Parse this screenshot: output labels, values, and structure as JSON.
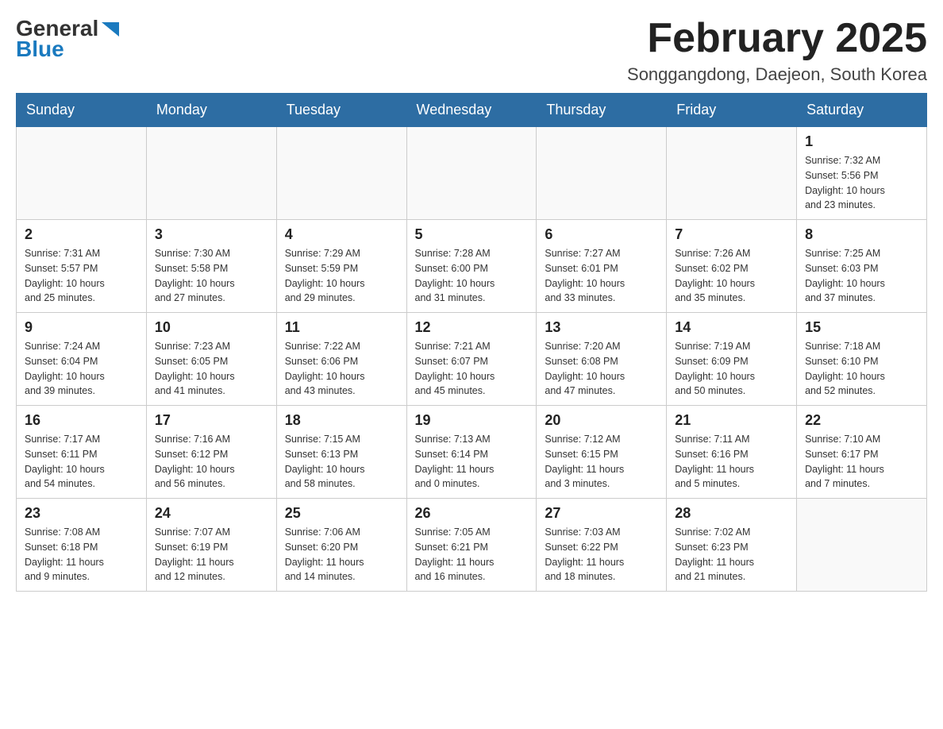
{
  "logo": {
    "general": "General",
    "blue": "Blue",
    "icon": "▶"
  },
  "header": {
    "title": "February 2025",
    "subtitle": "Songgangdong, Daejeon, South Korea"
  },
  "days_of_week": [
    "Sunday",
    "Monday",
    "Tuesday",
    "Wednesday",
    "Thursday",
    "Friday",
    "Saturday"
  ],
  "weeks": [
    [
      {
        "day": "",
        "info": ""
      },
      {
        "day": "",
        "info": ""
      },
      {
        "day": "",
        "info": ""
      },
      {
        "day": "",
        "info": ""
      },
      {
        "day": "",
        "info": ""
      },
      {
        "day": "",
        "info": ""
      },
      {
        "day": "1",
        "info": "Sunrise: 7:32 AM\nSunset: 5:56 PM\nDaylight: 10 hours\nand 23 minutes."
      }
    ],
    [
      {
        "day": "2",
        "info": "Sunrise: 7:31 AM\nSunset: 5:57 PM\nDaylight: 10 hours\nand 25 minutes."
      },
      {
        "day": "3",
        "info": "Sunrise: 7:30 AM\nSunset: 5:58 PM\nDaylight: 10 hours\nand 27 minutes."
      },
      {
        "day": "4",
        "info": "Sunrise: 7:29 AM\nSunset: 5:59 PM\nDaylight: 10 hours\nand 29 minutes."
      },
      {
        "day": "5",
        "info": "Sunrise: 7:28 AM\nSunset: 6:00 PM\nDaylight: 10 hours\nand 31 minutes."
      },
      {
        "day": "6",
        "info": "Sunrise: 7:27 AM\nSunset: 6:01 PM\nDaylight: 10 hours\nand 33 minutes."
      },
      {
        "day": "7",
        "info": "Sunrise: 7:26 AM\nSunset: 6:02 PM\nDaylight: 10 hours\nand 35 minutes."
      },
      {
        "day": "8",
        "info": "Sunrise: 7:25 AM\nSunset: 6:03 PM\nDaylight: 10 hours\nand 37 minutes."
      }
    ],
    [
      {
        "day": "9",
        "info": "Sunrise: 7:24 AM\nSunset: 6:04 PM\nDaylight: 10 hours\nand 39 minutes."
      },
      {
        "day": "10",
        "info": "Sunrise: 7:23 AM\nSunset: 6:05 PM\nDaylight: 10 hours\nand 41 minutes."
      },
      {
        "day": "11",
        "info": "Sunrise: 7:22 AM\nSunset: 6:06 PM\nDaylight: 10 hours\nand 43 minutes."
      },
      {
        "day": "12",
        "info": "Sunrise: 7:21 AM\nSunset: 6:07 PM\nDaylight: 10 hours\nand 45 minutes."
      },
      {
        "day": "13",
        "info": "Sunrise: 7:20 AM\nSunset: 6:08 PM\nDaylight: 10 hours\nand 47 minutes."
      },
      {
        "day": "14",
        "info": "Sunrise: 7:19 AM\nSunset: 6:09 PM\nDaylight: 10 hours\nand 50 minutes."
      },
      {
        "day": "15",
        "info": "Sunrise: 7:18 AM\nSunset: 6:10 PM\nDaylight: 10 hours\nand 52 minutes."
      }
    ],
    [
      {
        "day": "16",
        "info": "Sunrise: 7:17 AM\nSunset: 6:11 PM\nDaylight: 10 hours\nand 54 minutes."
      },
      {
        "day": "17",
        "info": "Sunrise: 7:16 AM\nSunset: 6:12 PM\nDaylight: 10 hours\nand 56 minutes."
      },
      {
        "day": "18",
        "info": "Sunrise: 7:15 AM\nSunset: 6:13 PM\nDaylight: 10 hours\nand 58 minutes."
      },
      {
        "day": "19",
        "info": "Sunrise: 7:13 AM\nSunset: 6:14 PM\nDaylight: 11 hours\nand 0 minutes."
      },
      {
        "day": "20",
        "info": "Sunrise: 7:12 AM\nSunset: 6:15 PM\nDaylight: 11 hours\nand 3 minutes."
      },
      {
        "day": "21",
        "info": "Sunrise: 7:11 AM\nSunset: 6:16 PM\nDaylight: 11 hours\nand 5 minutes."
      },
      {
        "day": "22",
        "info": "Sunrise: 7:10 AM\nSunset: 6:17 PM\nDaylight: 11 hours\nand 7 minutes."
      }
    ],
    [
      {
        "day": "23",
        "info": "Sunrise: 7:08 AM\nSunset: 6:18 PM\nDaylight: 11 hours\nand 9 minutes."
      },
      {
        "day": "24",
        "info": "Sunrise: 7:07 AM\nSunset: 6:19 PM\nDaylight: 11 hours\nand 12 minutes."
      },
      {
        "day": "25",
        "info": "Sunrise: 7:06 AM\nSunset: 6:20 PM\nDaylight: 11 hours\nand 14 minutes."
      },
      {
        "day": "26",
        "info": "Sunrise: 7:05 AM\nSunset: 6:21 PM\nDaylight: 11 hours\nand 16 minutes."
      },
      {
        "day": "27",
        "info": "Sunrise: 7:03 AM\nSunset: 6:22 PM\nDaylight: 11 hours\nand 18 minutes."
      },
      {
        "day": "28",
        "info": "Sunrise: 7:02 AM\nSunset: 6:23 PM\nDaylight: 11 hours\nand 21 minutes."
      },
      {
        "day": "",
        "info": ""
      }
    ]
  ]
}
